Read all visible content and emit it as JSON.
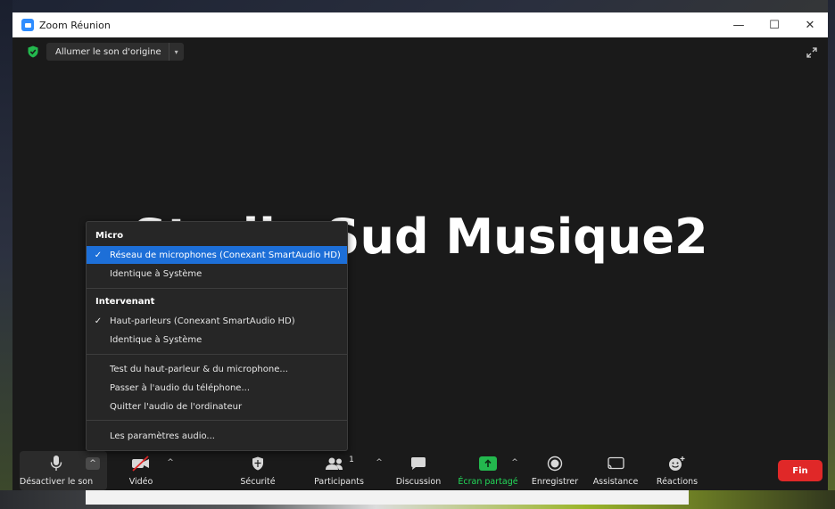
{
  "window": {
    "title": "Zoom Réunion",
    "minimize": "—",
    "maximize": "☐",
    "close": "✕"
  },
  "topbar": {
    "original_sound_label": "Allumer le son d'origine",
    "dropdown_glyph": "▾"
  },
  "participant_name": "Studio Sud Musique2",
  "audio_menu": {
    "micro_title": "Micro",
    "micro_items": [
      {
        "label": "Réseau de microphones (Conexant SmartAudio HD)",
        "checked": "✓"
      },
      {
        "label": "Identique à Système",
        "checked": ""
      }
    ],
    "speaker_title": "Intervenant",
    "speaker_items": [
      {
        "label": "Haut-parleurs (Conexant SmartAudio HD)",
        "checked": "✓"
      },
      {
        "label": "Identique à Système",
        "checked": ""
      }
    ],
    "actions": [
      "Test du haut-parleur & du microphone...",
      "Passer à l'audio du téléphone...",
      "Quitter l'audio de l'ordinateur"
    ],
    "settings": "Les paramètres audio..."
  },
  "toolbar": {
    "mute": "Désactiver le son",
    "video": "Vidéo",
    "security": "Sécurité",
    "participants": "Participants",
    "participants_count": "1",
    "chat": "Discussion",
    "share": "Écran partagé",
    "record": "Enregistrer",
    "assistance": "Assistance",
    "reactions": "Réactions",
    "end": "Fin",
    "caret": "^"
  },
  "colors": {
    "accent": "#1d6fd8",
    "share_green": "#23d959",
    "end_red": "#e02828",
    "shield_green": "#23b84e"
  },
  "icons": [
    "zoom-app-icon",
    "shield-icon",
    "expand-icon",
    "microphone-icon",
    "video-off-icon",
    "security-icon",
    "participants-icon",
    "chat-icon",
    "share-screen-icon",
    "record-icon",
    "assistance-icon",
    "reactions-icon"
  ]
}
